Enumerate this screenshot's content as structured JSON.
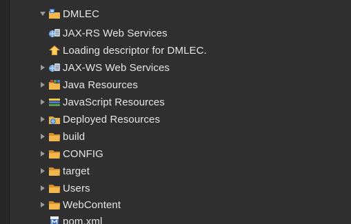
{
  "project_explorer": {
    "root": {
      "label": "DMLEC",
      "expanded": true,
      "icon": "project-folder-icon"
    },
    "items": [
      {
        "label": "JAX-RS Web Services",
        "icon": "web-services-icon",
        "expandable": false
      },
      {
        "label": "Loading descriptor for DMLEC.",
        "icon": "loading-descriptor-icon",
        "expandable": false
      },
      {
        "label": "JAX-WS Web Services",
        "icon": "web-services-icon",
        "expandable": true
      },
      {
        "label": "Java Resources",
        "icon": "java-resources-icon",
        "expandable": true
      },
      {
        "label": "JavaScript Resources",
        "icon": "javascript-resources-icon",
        "expandable": true
      },
      {
        "label": "Deployed Resources",
        "icon": "deployed-resources-icon",
        "expandable": true
      },
      {
        "label": "build",
        "icon": "folder-icon",
        "expandable": true
      },
      {
        "label": "CONFIG",
        "icon": "folder-icon",
        "expandable": true
      },
      {
        "label": "target",
        "icon": "folder-icon",
        "expandable": true
      },
      {
        "label": "Users",
        "icon": "folder-icon",
        "expandable": true
      },
      {
        "label": "WebContent",
        "icon": "folder-icon",
        "expandable": true
      },
      {
        "label": "pom.xml",
        "icon": "maven-file-icon",
        "expandable": false
      }
    ]
  },
  "colors": {
    "background": "#2f2f2f",
    "text": "#e6e6e6",
    "twisty": "#9a9a9a",
    "folder": "#e8a23a"
  }
}
